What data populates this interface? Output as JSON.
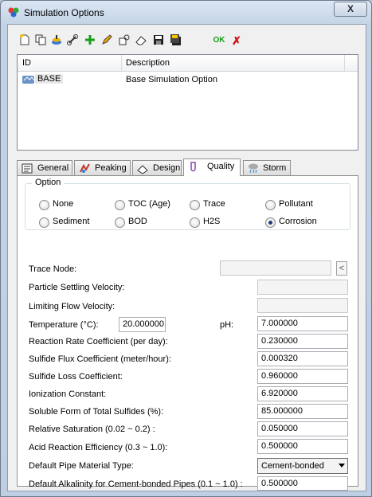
{
  "window": {
    "title": "Simulation Options",
    "close_label": "X"
  },
  "toolbar": {
    "buttons": [
      "new-icon",
      "copy-icon",
      "stack-icon",
      "link-icon",
      "add-icon",
      "edit-pencil-icon",
      "key-icon",
      "eraser-icon",
      "save-icon",
      "save-all-icon"
    ],
    "ok_label": "OK",
    "cancel_label": "✗"
  },
  "list": {
    "headers": {
      "id": "ID",
      "description": "Description"
    },
    "rows": [
      {
        "id": "BASE",
        "description": "Base Simulation Option"
      }
    ]
  },
  "tabs": [
    "General",
    "Peaking",
    "Design",
    "Quality",
    "Storm"
  ],
  "active_tab": "Quality",
  "option_group": {
    "label": "Option",
    "radios": [
      "None",
      "TOC (Age)",
      "Trace",
      "Pollutant",
      "Sediment",
      "BOD",
      "H2S",
      "Corrosion"
    ],
    "selected": "Corrosion"
  },
  "fields": {
    "trace_node": {
      "label": "Trace Node:",
      "value": "",
      "button": "<"
    },
    "particle_settling": {
      "label": "Particle Settling Velocity:",
      "value": ""
    },
    "limiting_flow": {
      "label": "Limiting Flow Velocity:",
      "value": ""
    },
    "temperature": {
      "label": "Temperature (°C):",
      "value": "20.000000"
    },
    "ph": {
      "label": "pH:",
      "value": "7.000000"
    },
    "reaction_rate": {
      "label": "Reaction Rate Coefficient (per day):",
      "value": "0.230000"
    },
    "sulfide_flux": {
      "label": "Sulfide Flux Coefficient (meter/hour):",
      "value": "0.000320"
    },
    "sulfide_loss": {
      "label": "Sulfide Loss Coefficient:",
      "value": "0.960000"
    },
    "ionization": {
      "label": "Ionization Constant:",
      "value": "6.920000"
    },
    "soluble_form": {
      "label": "Soluble Form of Total Sulfides (%):",
      "value": "85.000000"
    },
    "relative_saturation": {
      "label": "Relative Saturation (0.02 ~ 0.2) :",
      "value": "0.050000"
    },
    "acid_reaction": {
      "label": "Acid Reaction Efficiency (0.3 ~ 1.0):",
      "value": "0.500000"
    },
    "pipe_material": {
      "label": "Default Pipe Material Type:",
      "value": "Cement-bonded"
    },
    "alkalinity": {
      "label": "Default Alkalinity for Cement-bonded Pipes (0.1 ~ 1.0) :",
      "value": "0.500000"
    }
  }
}
